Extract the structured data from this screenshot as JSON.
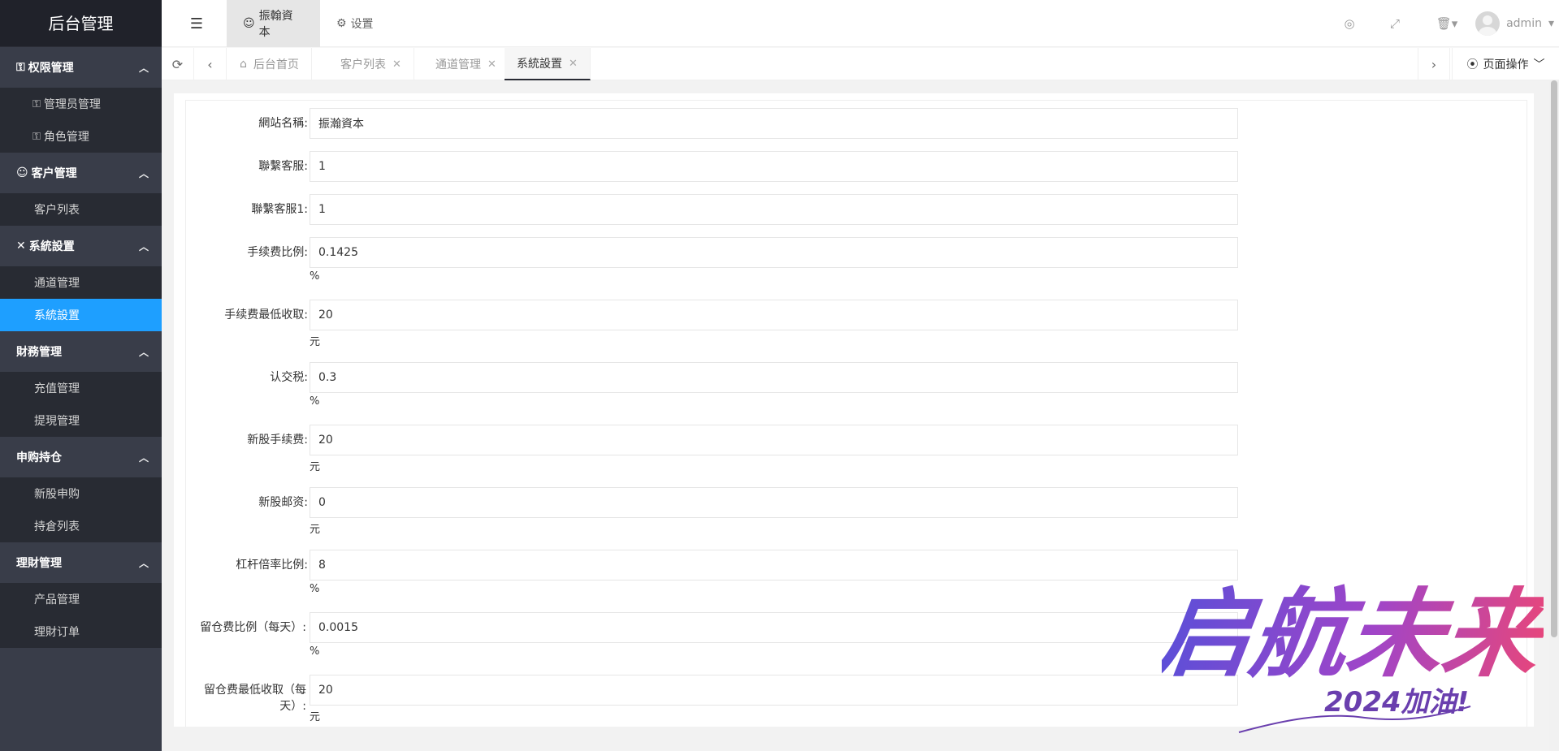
{
  "sidebar": {
    "logo": "后台管理",
    "groups": [
      {
        "label": "权限管理",
        "items": [
          {
            "label": "管理员管理"
          },
          {
            "label": "角色管理"
          }
        ]
      },
      {
        "label": "客户管理",
        "items": [
          {
            "label": "客户列表"
          }
        ]
      },
      {
        "label": "系統設置",
        "items": [
          {
            "label": "通道管理"
          },
          {
            "label": "系統設置"
          }
        ]
      },
      {
        "label": "財務管理",
        "items": [
          {
            "label": "充值管理"
          },
          {
            "label": "提現管理"
          }
        ]
      },
      {
        "label": "申购持仓",
        "items": [
          {
            "label": "新股申购"
          },
          {
            "label": "持倉列表"
          }
        ]
      },
      {
        "label": "理財管理",
        "items": [
          {
            "label": "产品管理"
          },
          {
            "label": "理財订单"
          }
        ]
      }
    ]
  },
  "header": {
    "tabs": [
      {
        "label": "振翰資本"
      },
      {
        "label": "设置"
      }
    ],
    "user": "admin"
  },
  "tabbar": {
    "tabs": [
      {
        "label": "后台首页"
      },
      {
        "label": "客户列表"
      },
      {
        "label": "通道管理"
      },
      {
        "label": "系統設置"
      }
    ],
    "page_ops": "页面操作"
  },
  "form": {
    "fields": [
      {
        "label": "網站名稱:",
        "value": "振瀚資本",
        "unit": ""
      },
      {
        "label": "聯繫客服:",
        "value": "1",
        "unit": ""
      },
      {
        "label": "聯繫客服1:",
        "value": "1",
        "unit": ""
      },
      {
        "label": "手续费比例:",
        "value": "0.1425",
        "unit": "%"
      },
      {
        "label": "手续费最低收取:",
        "value": "20",
        "unit": "元"
      },
      {
        "label": "认交税:",
        "value": "0.3",
        "unit": "%"
      },
      {
        "label": "新股手续费:",
        "value": "20",
        "unit": "元"
      },
      {
        "label": "新股邮资:",
        "value": "0",
        "unit": "元"
      },
      {
        "label": "杠杆倍率比例:",
        "value": "8",
        "unit": "%"
      },
      {
        "label": "留仓费比例（每天）:",
        "value": "0.0015",
        "unit": "%"
      },
      {
        "label": "留仓费最低收取（每天）:",
        "value": "20",
        "unit": "元"
      }
    ]
  },
  "watermark": {
    "line1": "启航未来",
    "line2": "2024加油!"
  }
}
